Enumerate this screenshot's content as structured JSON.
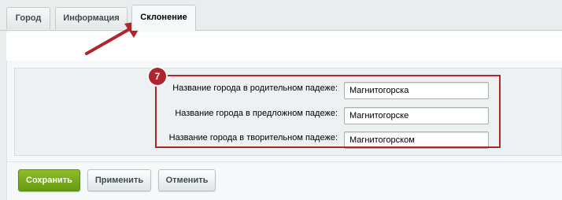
{
  "tabs": [
    {
      "label": "Город",
      "active": false
    },
    {
      "label": "Информация",
      "active": false
    },
    {
      "label": "Склонение",
      "active": true
    }
  ],
  "annotation": {
    "badge": "7",
    "color": "#b0252d"
  },
  "form": {
    "fields": [
      {
        "label": "Название города в родительном падеже:",
        "value": "Магнитогорска"
      },
      {
        "label": "Название города в предложном падеже:",
        "value": "Магнитогорске"
      },
      {
        "label": "Название города в творительном падеже:",
        "value": "Магнитогорском"
      }
    ]
  },
  "buttons": {
    "save": "Сохранить",
    "apply": "Применить",
    "cancel": "Отменить"
  },
  "colors": {
    "accent_green": "#7aad1d",
    "highlight_red": "#b0252d"
  }
}
